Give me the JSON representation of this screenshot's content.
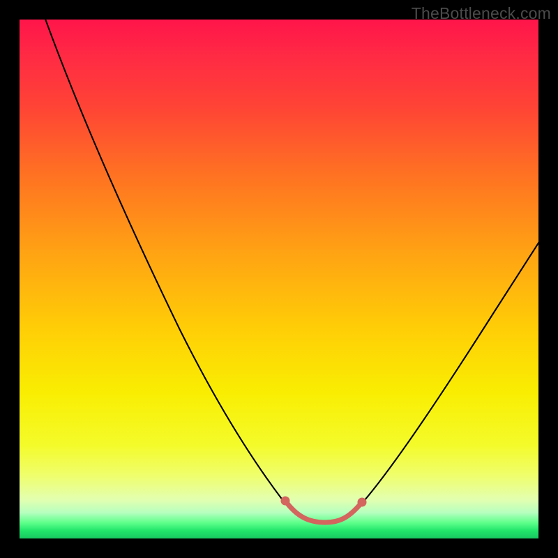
{
  "watermark": "TheBottleneck.com",
  "chart_data": {
    "type": "line",
    "title": "",
    "xlabel": "",
    "ylabel": "",
    "xlim": [
      0,
      100
    ],
    "ylim": [
      0,
      100
    ],
    "grid": false,
    "legend": false,
    "series": [
      {
        "name": "bottleneck-curve",
        "color": "#000000",
        "x": [
          4,
          10,
          16,
          22,
          28,
          34,
          40,
          46,
          51,
          53,
          55,
          57,
          59,
          61,
          63,
          67,
          72,
          78,
          85,
          92,
          100
        ],
        "y": [
          100,
          87,
          75,
          63,
          52,
          41,
          31,
          22,
          13,
          8,
          5,
          3.8,
          3.2,
          3.2,
          3.5,
          5,
          10,
          18,
          30,
          43,
          58
        ]
      },
      {
        "name": "optimal-flat-marker",
        "color": "#d3645e",
        "x": [
          51.5,
          53,
          55,
          57,
          59,
          61,
          63
        ],
        "y": [
          6.5,
          4.2,
          3.6,
          3.4,
          3.4,
          3.8,
          5.4
        ]
      }
    ],
    "background_gradient": {
      "top": "#ff154a",
      "upper_mid": "#ffa313",
      "mid": "#f9ee02",
      "lower": "#21e56a"
    }
  }
}
